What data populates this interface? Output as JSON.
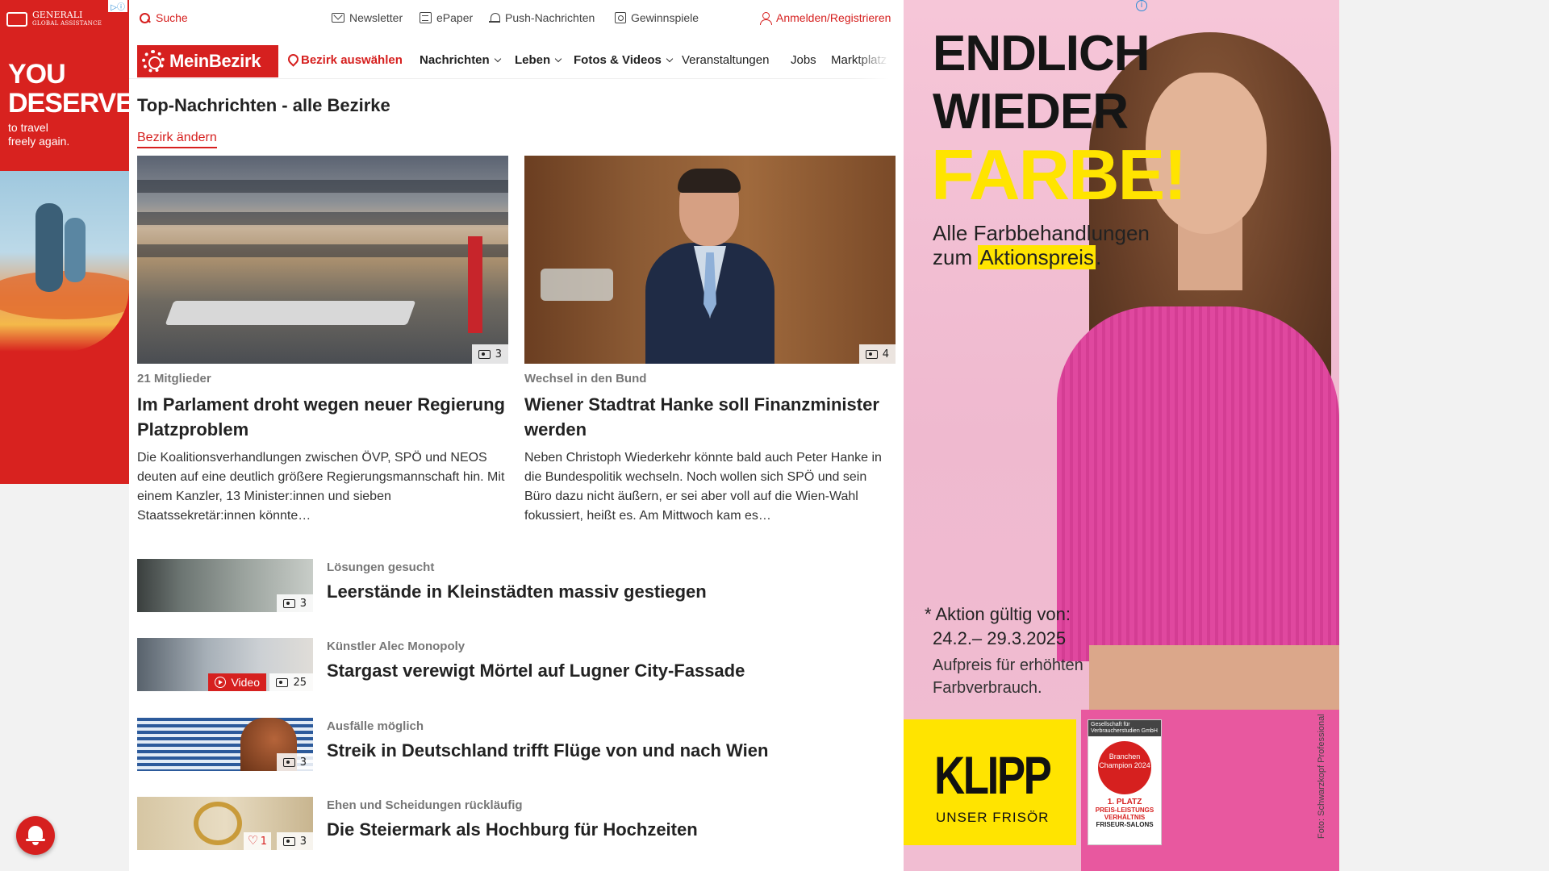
{
  "ad_left": {
    "brand_line1": "GENERALI",
    "brand_line2": "GLOBAL ASSISTANCE",
    "headline_1": "YOU",
    "headline_2": "DESERVE",
    "sub_1": "to travel",
    "sub_2": "freely again.",
    "ad_choice": "▷ⓘ"
  },
  "topbar": {
    "search": "Suche",
    "newsletter": "Newsletter",
    "epaper": "ePaper",
    "push": "Push-Nachrichten",
    "games": "Gewinnspiele",
    "login": "Anmelden/Registrieren"
  },
  "navbar": {
    "logo": "MeinBezirk",
    "district": "Bezirk auswählen",
    "items": [
      "Nachrichten",
      "Leben",
      "Fotos & Videos",
      "Veranstaltungen",
      "Jobs",
      "Marktplatz"
    ]
  },
  "page": {
    "title": "Top-Nachrichten - alle Bezirke",
    "change_district": "Bezirk ändern"
  },
  "featured": [
    {
      "photo_count": "3",
      "kicker": "21 Mitglieder",
      "headline": "Im Parlament droht wegen neuer Regierung Platzproblem",
      "teaser": "Die Koalitionsverhandlungen zwischen ÖVP, SPÖ und NEOS deuten auf eine deutlich größere Regierungsmannschaft hin. Mit einem Kanzler, 13 Minister:innen und sieben Staatssekretär:innen könnte…"
    },
    {
      "photo_count": "4",
      "kicker": "Wechsel in den Bund",
      "headline": "Wiener Stadtrat Hanke soll Finanzminister werden",
      "teaser": "Neben Christoph Wiederkehr könnte bald auch Peter Hanke in die Bundespolitik wechseln. Noch wollen sich SPÖ und sein Büro dazu nicht äußern, er sei aber voll auf die Wien-Wahl fokussiert, heißt es. Am Mittwoch kam es…"
    }
  ],
  "list": [
    {
      "kicker": "Lösungen gesucht",
      "headline": "Leerstände in Kleinstädten massiv gestiegen",
      "photo_count": "3"
    },
    {
      "kicker": "Künstler Alec Monopoly",
      "headline": "Stargast verewigt Mörtel auf Lugner City-Fassade",
      "photo_count": "25",
      "video_label": "Video"
    },
    {
      "kicker": "Ausfälle möglich",
      "headline": "Streik in Deutschland trifft Flüge von und nach Wien",
      "photo_count": "3"
    },
    {
      "kicker": "Ehen und Scheidungen rückläufig",
      "headline": "Die Steiermark als Hochburg für Hochzeiten",
      "photo_count": "3",
      "like_count": "1"
    }
  ],
  "ad_right": {
    "line1": "ENDLICH",
    "line2": "WIEDER",
    "line3": "FARBE!",
    "sub_1": "Alle Farbbehandlungen",
    "sub_2_pre": "zum ",
    "sub_2_hl": "Aktionspreis",
    "sub_2_post": ".",
    "note_1": "* Aktion gültig von:",
    "note_2": "24.2.– 29.3.2025",
    "note_3": "Aufpreis für erhöhten",
    "note_4": "Farbverbrauch.",
    "brand": "KLIPP",
    "brand_sub": "UNSER FRISÖR",
    "seal_head": "Gesellschaft für Verbraucherstudien GmbH",
    "seal_circle": "Branchen Champion 2024",
    "seal_place": "1. PLATZ",
    "seal_award": "PREIS-LEISTUNGS VERHÄLTNIS",
    "seal_cat": "FRISEUR-SALONS",
    "credit": "Foto: Schwarzkopf Professional"
  },
  "colors": {
    "brand_red": "#d6201f",
    "ad_yellow": "#ffe400",
    "ad_pink": "#f1bdd2"
  },
  "icons": [
    "search-icon",
    "mail-icon",
    "epaper-icon",
    "bell-icon",
    "gift-icon",
    "user-icon",
    "pin-icon",
    "camera-icon",
    "play-icon",
    "heart-icon",
    "notification-bell-icon"
  ]
}
